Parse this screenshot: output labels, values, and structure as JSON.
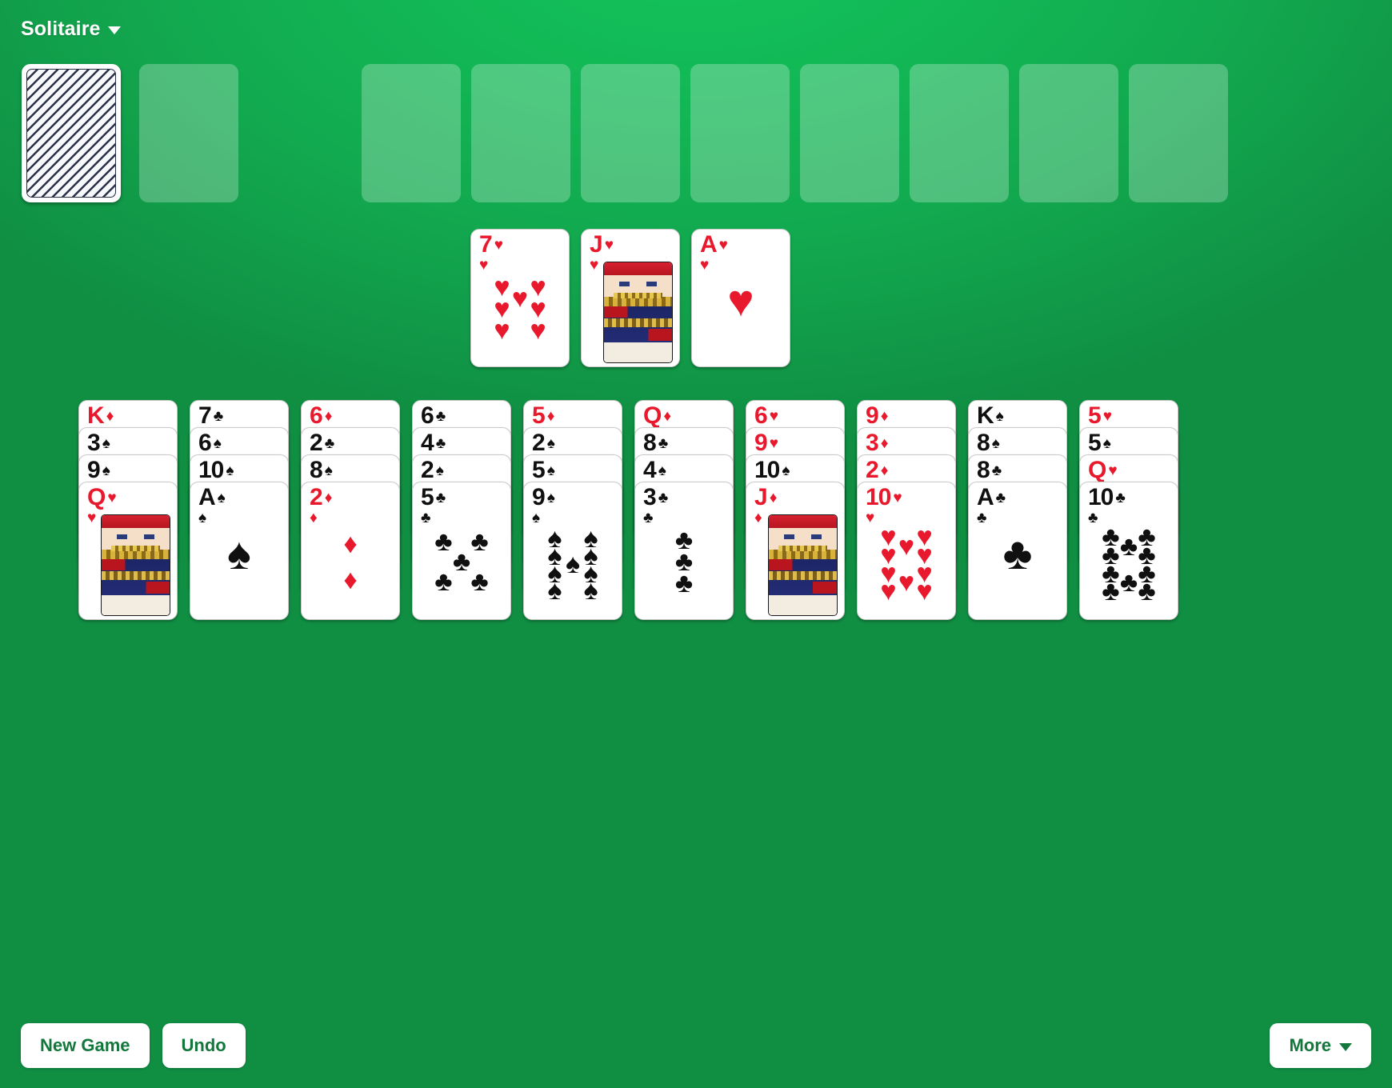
{
  "app": {
    "title": "Solitaire",
    "title_caret_icon": "chevron-down-icon",
    "table_color": "#12a94f",
    "card_red": "#e8192c",
    "card_black": "#101010",
    "empty_slot_color": "rgba(255,255,255,0.26)"
  },
  "stock": {
    "name": "stock-pile",
    "face_down": true,
    "back_pattern": "diagonal-stripes"
  },
  "waste": {
    "name": "waste-pile",
    "empty": true
  },
  "foundations": [
    {
      "empty": true
    },
    {
      "empty": true
    },
    {
      "empty": true
    },
    {
      "empty": true
    },
    {
      "empty": true
    },
    {
      "empty": true
    },
    {
      "empty": true
    },
    {
      "empty": true
    }
  ],
  "free_row": [
    {
      "rank": "7",
      "suit": "hearts",
      "suit_glyph": "♥",
      "color": "red",
      "face": false
    },
    {
      "rank": "J",
      "suit": "hearts",
      "suit_glyph": "♥",
      "color": "red",
      "face": true
    },
    {
      "rank": "A",
      "suit": "hearts",
      "suit_glyph": "♥",
      "color": "red",
      "face": false
    }
  ],
  "tableau": [
    {
      "column": 1,
      "cards": [
        {
          "rank": "K",
          "suit": "diamonds",
          "suit_glyph": "♦",
          "color": "red",
          "face": false
        },
        {
          "rank": "3",
          "suit": "spades",
          "suit_glyph": "♠",
          "color": "black",
          "face": false
        },
        {
          "rank": "9",
          "suit": "spades",
          "suit_glyph": "♠",
          "color": "black",
          "face": false
        },
        {
          "rank": "Q",
          "suit": "hearts",
          "suit_glyph": "♥",
          "color": "red",
          "face": true
        }
      ]
    },
    {
      "column": 2,
      "cards": [
        {
          "rank": "7",
          "suit": "clubs",
          "suit_glyph": "♣",
          "color": "black",
          "face": false
        },
        {
          "rank": "6",
          "suit": "spades",
          "suit_glyph": "♠",
          "color": "black",
          "face": false
        },
        {
          "rank": "10",
          "suit": "spades",
          "suit_glyph": "♠",
          "color": "black",
          "face": false
        },
        {
          "rank": "A",
          "suit": "spades",
          "suit_glyph": "♠",
          "color": "black",
          "face": false
        }
      ]
    },
    {
      "column": 3,
      "cards": [
        {
          "rank": "6",
          "suit": "diamonds",
          "suit_glyph": "♦",
          "color": "red",
          "face": false
        },
        {
          "rank": "2",
          "suit": "clubs",
          "suit_glyph": "♣",
          "color": "black",
          "face": false
        },
        {
          "rank": "8",
          "suit": "spades",
          "suit_glyph": "♠",
          "color": "black",
          "face": false
        },
        {
          "rank": "2",
          "suit": "diamonds",
          "suit_glyph": "♦",
          "color": "red",
          "face": false
        }
      ]
    },
    {
      "column": 4,
      "cards": [
        {
          "rank": "6",
          "suit": "clubs",
          "suit_glyph": "♣",
          "color": "black",
          "face": false
        },
        {
          "rank": "4",
          "suit": "clubs",
          "suit_glyph": "♣",
          "color": "black",
          "face": false
        },
        {
          "rank": "2",
          "suit": "spades",
          "suit_glyph": "♠",
          "color": "black",
          "face": false
        },
        {
          "rank": "5",
          "suit": "clubs",
          "suit_glyph": "♣",
          "color": "black",
          "face": false
        }
      ]
    },
    {
      "column": 5,
      "cards": [
        {
          "rank": "5",
          "suit": "diamonds",
          "suit_glyph": "♦",
          "color": "red",
          "face": false
        },
        {
          "rank": "2",
          "suit": "spades",
          "suit_glyph": "♠",
          "color": "black",
          "face": false
        },
        {
          "rank": "5",
          "suit": "spades",
          "suit_glyph": "♠",
          "color": "black",
          "face": false
        },
        {
          "rank": "9",
          "suit": "spades",
          "suit_glyph": "♠",
          "color": "black",
          "face": false
        }
      ]
    },
    {
      "column": 6,
      "cards": [
        {
          "rank": "Q",
          "suit": "diamonds",
          "suit_glyph": "♦",
          "color": "red",
          "face": false
        },
        {
          "rank": "8",
          "suit": "clubs",
          "suit_glyph": "♣",
          "color": "black",
          "face": false
        },
        {
          "rank": "4",
          "suit": "spades",
          "suit_glyph": "♠",
          "color": "black",
          "face": false
        },
        {
          "rank": "3",
          "suit": "clubs",
          "suit_glyph": "♣",
          "color": "black",
          "face": false
        }
      ]
    },
    {
      "column": 7,
      "cards": [
        {
          "rank": "6",
          "suit": "hearts",
          "suit_glyph": "♥",
          "color": "red",
          "face": false
        },
        {
          "rank": "9",
          "suit": "hearts",
          "suit_glyph": "♥",
          "color": "red",
          "face": false
        },
        {
          "rank": "10",
          "suit": "spades",
          "suit_glyph": "♠",
          "color": "black",
          "face": false
        },
        {
          "rank": "J",
          "suit": "diamonds",
          "suit_glyph": "♦",
          "color": "red",
          "face": true
        }
      ]
    },
    {
      "column": 8,
      "cards": [
        {
          "rank": "9",
          "suit": "diamonds",
          "suit_glyph": "♦",
          "color": "red",
          "face": false
        },
        {
          "rank": "3",
          "suit": "diamonds",
          "suit_glyph": "♦",
          "color": "red",
          "face": false
        },
        {
          "rank": "2",
          "suit": "diamonds",
          "suit_glyph": "♦",
          "color": "red",
          "face": false
        },
        {
          "rank": "10",
          "suit": "hearts",
          "suit_glyph": "♥",
          "color": "red",
          "face": false
        }
      ]
    },
    {
      "column": 9,
      "cards": [
        {
          "rank": "K",
          "suit": "spades",
          "suit_glyph": "♠",
          "color": "black",
          "face": false
        },
        {
          "rank": "8",
          "suit": "spades",
          "suit_glyph": "♠",
          "color": "black",
          "face": false
        },
        {
          "rank": "8",
          "suit": "clubs",
          "suit_glyph": "♣",
          "color": "black",
          "face": false
        },
        {
          "rank": "A",
          "suit": "clubs",
          "suit_glyph": "♣",
          "color": "black",
          "face": false
        }
      ]
    },
    {
      "column": 10,
      "cards": [
        {
          "rank": "5",
          "suit": "hearts",
          "suit_glyph": "♥",
          "color": "red",
          "face": false
        },
        {
          "rank": "5",
          "suit": "spades",
          "suit_glyph": "♠",
          "color": "black",
          "face": false
        },
        {
          "rank": "Q",
          "suit": "hearts",
          "suit_glyph": "♥",
          "color": "red",
          "face": false
        },
        {
          "rank": "10",
          "suit": "clubs",
          "suit_glyph": "♣",
          "color": "black",
          "face": false
        }
      ]
    }
  ],
  "toolbar": {
    "new_game_label": "New Game",
    "undo_label": "Undo",
    "more_label": "More",
    "more_caret_icon": "chevron-down-icon"
  }
}
